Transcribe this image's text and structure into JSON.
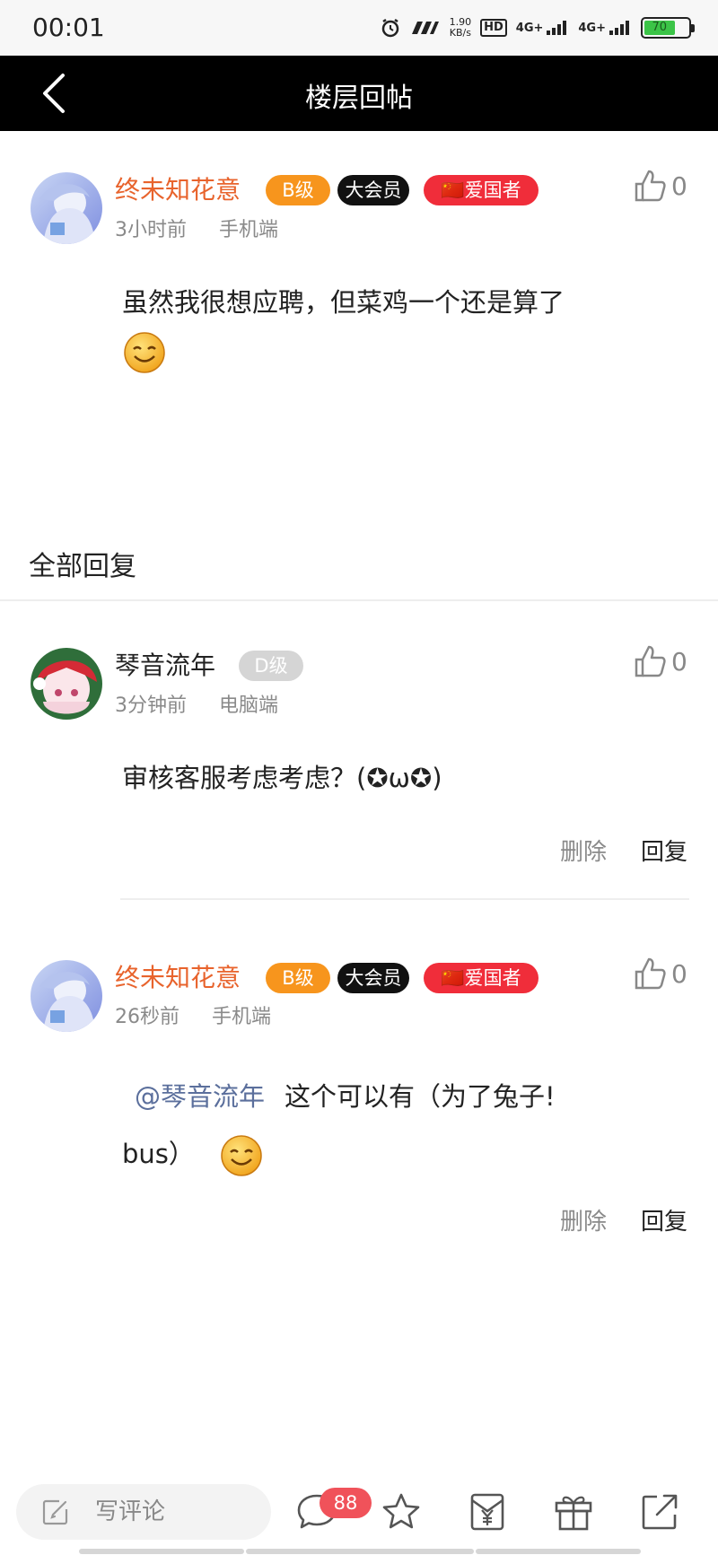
{
  "status_bar": {
    "time": "00:01",
    "speed_value": "1.90",
    "speed_unit": "KB/s",
    "hd_label": "HD",
    "net1": "4G+",
    "net2": "4G+",
    "battery_level": "70"
  },
  "header": {
    "title": "楼层回帖"
  },
  "main_post": {
    "username": "终未知花意",
    "badges": [
      "B级",
      "大会员",
      "🇨🇳爱国者"
    ],
    "time": "3小时前",
    "device": "手机端",
    "like_count": "0",
    "text": "虽然我很想应聘，但菜鸡一个还是算了"
  },
  "replies_section": {
    "title": "全部回复"
  },
  "replies": [
    {
      "username": "琴音流年",
      "badge": "D级",
      "time": "3分钟前",
      "device": "电脑端",
      "like_count": "0",
      "text": "审核客服考虑考虑？(✪ω✪)",
      "delete_label": "删除",
      "reply_label": "回复"
    },
    {
      "username": "终未知花意",
      "badges": [
        "B级",
        "大会员",
        "🇨🇳爱国者"
      ],
      "time": "26秒前",
      "device": "手机端",
      "like_count": "0",
      "mention": "@琴音流年",
      "text_line1": "这个可以有（为了兔子!",
      "text_line2": "bus）",
      "delete_label": "删除",
      "reply_label": "回复"
    }
  ],
  "toolbar": {
    "comment_placeholder": "写评论",
    "comment_count": "88"
  },
  "colors": {
    "username_orange": "#e8632c",
    "badge_b": "#f7951d",
    "badge_vip": "#111111",
    "badge_patriot": "#f02d3a",
    "badge_d": "#d5d5d5",
    "mention": "#5b6f9c",
    "count_badge": "#f0525a"
  }
}
